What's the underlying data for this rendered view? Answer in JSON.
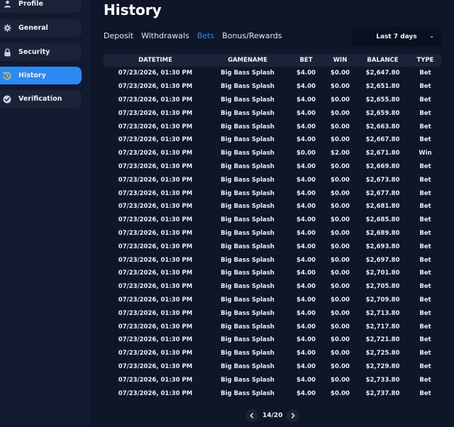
{
  "sidebar": {
    "items": [
      {
        "label": "Profile",
        "icon": "user-icon"
      },
      {
        "label": "General",
        "icon": "gear-icon"
      },
      {
        "label": "Security",
        "icon": "lock-icon"
      },
      {
        "label": "History",
        "icon": "history-icon",
        "active": true
      },
      {
        "label": "Verification",
        "icon": "check-circle-icon"
      }
    ]
  },
  "page": {
    "title": "History"
  },
  "tabs": [
    {
      "label": "Deposit"
    },
    {
      "label": "Withdrawals"
    },
    {
      "label": "Bets",
      "active": true
    },
    {
      "label": "Bonus/Rewards"
    }
  ],
  "filter": {
    "selected": "Last 7 days"
  },
  "table": {
    "headers": [
      "DATETIME",
      "GAMENAME",
      "BET",
      "WIN",
      "BALANCE",
      "TYPE"
    ],
    "rows": [
      [
        "07/23/2026, 01:30 PM",
        "Big Bass Splash",
        "$4.00",
        "$0.00",
        "$2,647.80",
        "Bet"
      ],
      [
        "07/23/2026, 01:30 PM",
        "Big Bass Splash",
        "$4.00",
        "$0.00",
        "$2,651.80",
        "Bet"
      ],
      [
        "07/23/2026, 01:30 PM",
        "Big Bass Splash",
        "$4.00",
        "$0.00",
        "$2,655.80",
        "Bet"
      ],
      [
        "07/23/2026, 01:30 PM",
        "Big Bass Splash",
        "$4.00",
        "$0.00",
        "$2,659.80",
        "Bet"
      ],
      [
        "07/23/2026, 01:30 PM",
        "Big Bass Splash",
        "$4.00",
        "$0.00",
        "$2,663.80",
        "Bet"
      ],
      [
        "07/23/2026, 01:30 PM",
        "Big Bass Splash",
        "$4.00",
        "$0.00",
        "$2,667.80",
        "Bet"
      ],
      [
        "07/23/2026, 01:30 PM",
        "Big Bass Splash",
        "$0.00",
        "$2.00",
        "$2,671.80",
        "Win"
      ],
      [
        "07/23/2026, 01:30 PM",
        "Big Bass Splash",
        "$4.00",
        "$0.00",
        "$2,669.80",
        "Bet"
      ],
      [
        "07/23/2026, 01:30 PM",
        "Big Bass Splash",
        "$4.00",
        "$0.00",
        "$2,673.80",
        "Bet"
      ],
      [
        "07/23/2026, 01:30 PM",
        "Big Bass Splash",
        "$4.00",
        "$0.00",
        "$2,677.80",
        "Bet"
      ],
      [
        "07/23/2026, 01:30 PM",
        "Big Bass Splash",
        "$4.00",
        "$0.00",
        "$2,681.80",
        "Bet"
      ],
      [
        "07/23/2026, 01:30 PM",
        "Big Bass Splash",
        "$4.00",
        "$0.00",
        "$2,685.80",
        "Bet"
      ],
      [
        "07/23/2026, 01:30 PM",
        "Big Bass Splash",
        "$4.00",
        "$0.00",
        "$2,689.80",
        "Bet"
      ],
      [
        "07/23/2026, 01:30 PM",
        "Big Bass Splash",
        "$4.00",
        "$0.00",
        "$2,693.80",
        "Bet"
      ],
      [
        "07/23/2026, 01:30 PM",
        "Big Bass Splash",
        "$4.00",
        "$0.00",
        "$2,697.80",
        "Bet"
      ],
      [
        "07/23/2026, 01:30 PM",
        "Big Bass Splash",
        "$4.00",
        "$0.00",
        "$2,701.80",
        "Bet"
      ],
      [
        "07/23/2026, 01:30 PM",
        "Big Bass Splash",
        "$4.00",
        "$0.00",
        "$2,705.80",
        "Bet"
      ],
      [
        "07/23/2026, 01:30 PM",
        "Big Bass Splash",
        "$4.00",
        "$0.00",
        "$2,709.80",
        "Bet"
      ],
      [
        "07/23/2026, 01:30 PM",
        "Big Bass Splash",
        "$4.00",
        "$0.00",
        "$2,713.80",
        "Bet"
      ],
      [
        "07/23/2026, 01:30 PM",
        "Big Bass Splash",
        "$4.00",
        "$0.00",
        "$2,717.80",
        "Bet"
      ],
      [
        "07/23/2026, 01:30 PM",
        "Big Bass Splash",
        "$4.00",
        "$0.00",
        "$2,721.80",
        "Bet"
      ],
      [
        "07/23/2026, 01:30 PM",
        "Big Bass Splash",
        "$4.00",
        "$0.00",
        "$2,725.80",
        "Bet"
      ],
      [
        "07/23/2026, 01:30 PM",
        "Big Bass Splash",
        "$4.00",
        "$0.00",
        "$2,729.80",
        "Bet"
      ],
      [
        "07/23/2026, 01:30 PM",
        "Big Bass Splash",
        "$4.00",
        "$0.00",
        "$2,733.80",
        "Bet"
      ],
      [
        "07/23/2026, 01:30 PM",
        "Big Bass Splash",
        "$4.00",
        "$0.00",
        "$2,737.80",
        "Bet"
      ]
    ]
  },
  "pagination": {
    "text": "14/20"
  },
  "colors": {
    "background": "#0f1629",
    "sidebar": "#111a2e",
    "panel": "#1a2338",
    "accent": "#2a8af2",
    "text": "#e9edf6"
  }
}
